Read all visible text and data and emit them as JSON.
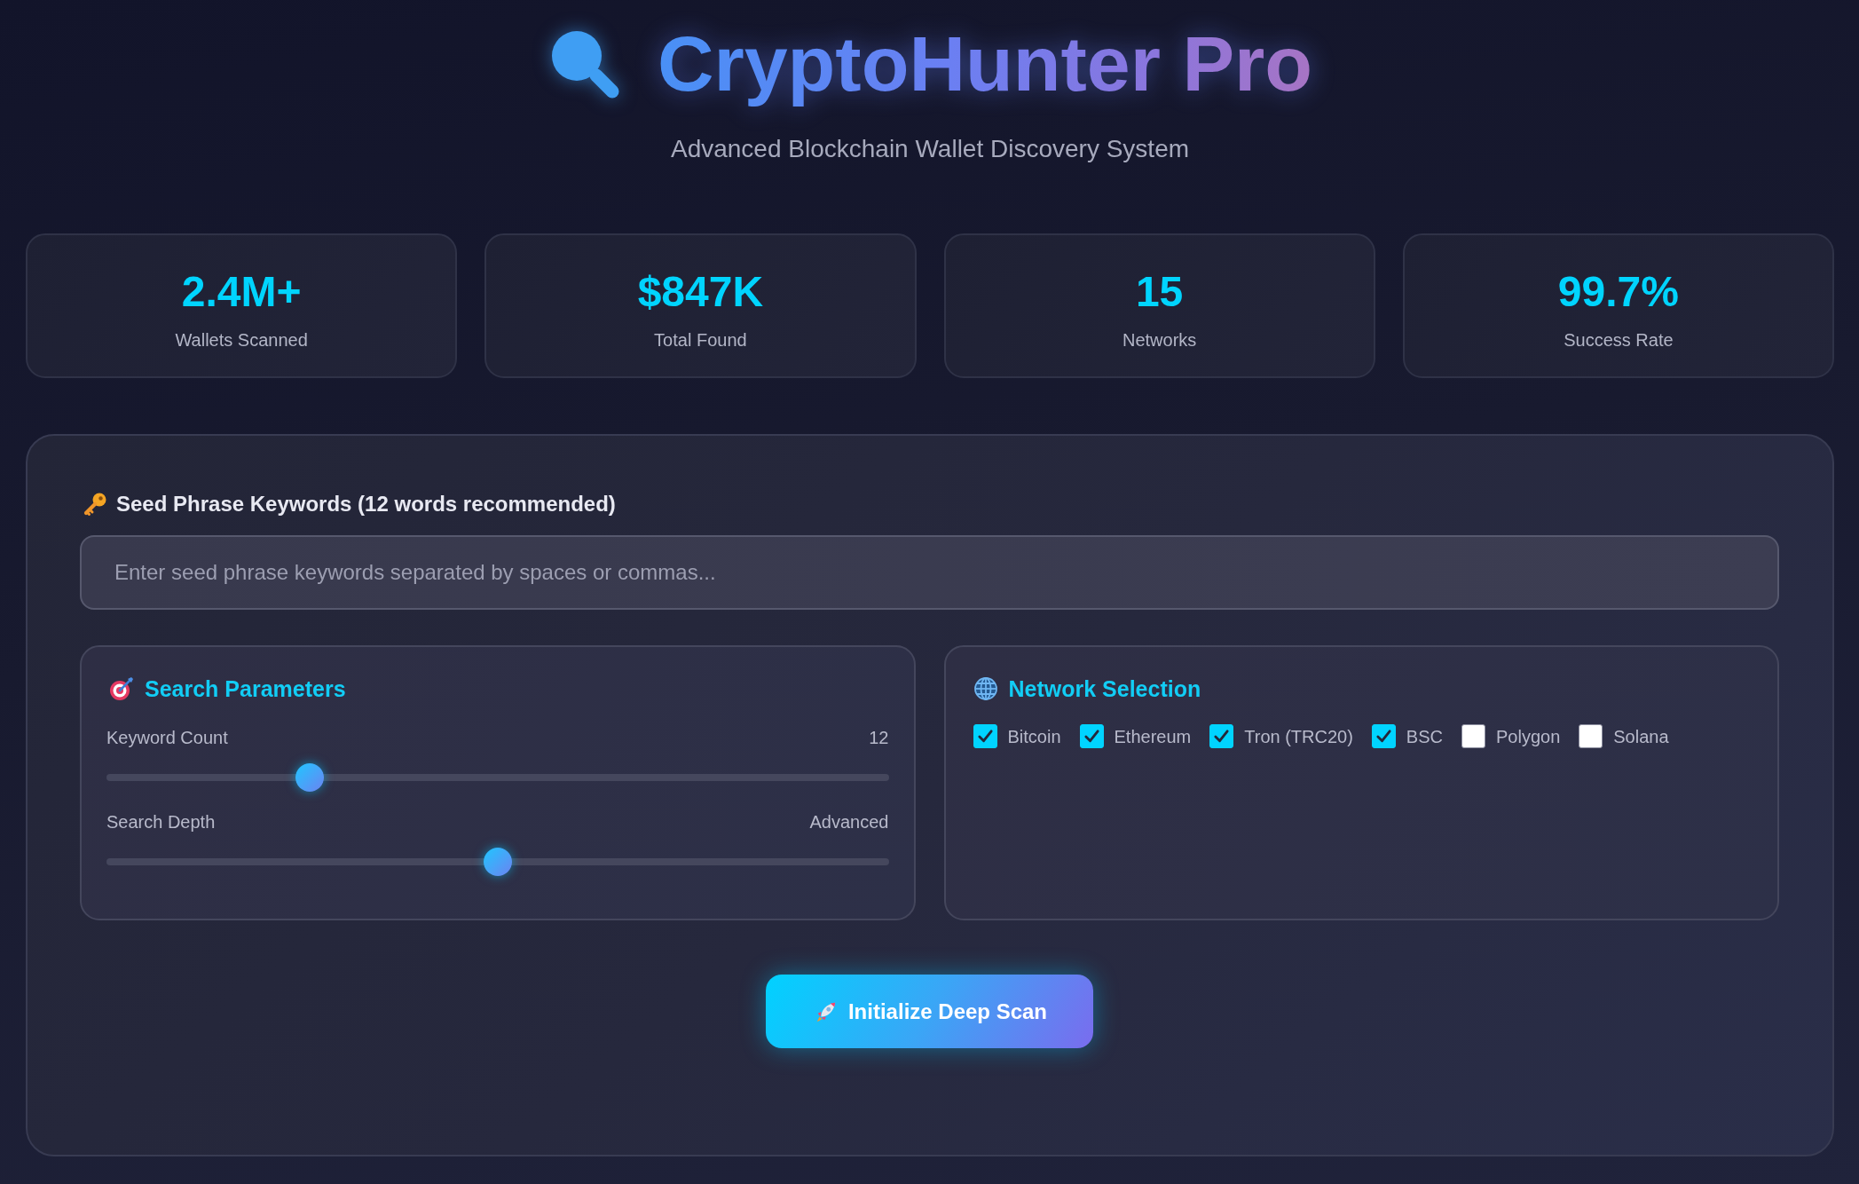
{
  "header": {
    "title": "CryptoHunter Pro",
    "subtitle": "Advanced Blockchain Wallet Discovery System"
  },
  "stats": [
    {
      "value": "2.4M+",
      "label": "Wallets Scanned"
    },
    {
      "value": "$847K",
      "label": "Total Found"
    },
    {
      "value": "15",
      "label": "Networks"
    },
    {
      "value": "99.7%",
      "label": "Success Rate"
    }
  ],
  "seed_phrase": {
    "label": "Seed Phrase Keywords (12 words recommended)",
    "placeholder": "Enter seed phrase keywords separated by spaces or commas..."
  },
  "search_parameters": {
    "title": "Search Parameters",
    "sliders": [
      {
        "label": "Keyword Count",
        "reading": "12",
        "level": 0.26
      },
      {
        "label": "Search Depth",
        "reading": "Advanced",
        "level": 0.5
      }
    ]
  },
  "network_selection": {
    "title": "Network Selection",
    "networks": [
      {
        "label": "Bitcoin",
        "checked": true
      },
      {
        "label": "Ethereum",
        "checked": true
      },
      {
        "label": "Tron (TRC20)",
        "checked": true
      },
      {
        "label": "BSC",
        "checked": true
      },
      {
        "label": "Polygon",
        "checked": false
      },
      {
        "label": "Solana",
        "checked": false
      }
    ]
  },
  "scan_button": {
    "label": "Initialize Deep Scan"
  }
}
